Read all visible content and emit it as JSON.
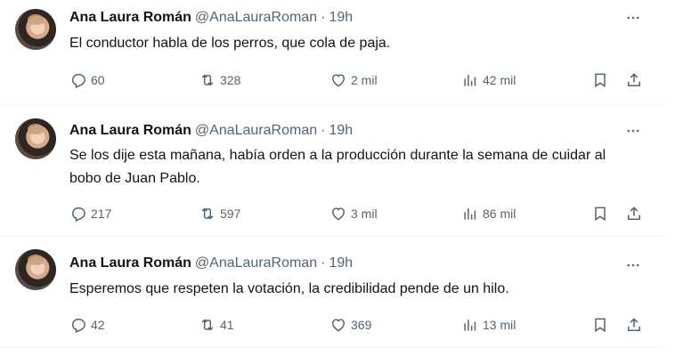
{
  "tweets": [
    {
      "name": "Ana Laura Román",
      "handle": "@AnaLauraRoman",
      "separator": "·",
      "time": "19h",
      "text": "El conductor habla de los perros, que cola de paja.",
      "replies": "60",
      "retweets": "328",
      "likes": "2 mil",
      "views": "42 mil"
    },
    {
      "name": "Ana Laura Román",
      "handle": "@AnaLauraRoman",
      "separator": "·",
      "time": "19h",
      "text": "Se los dije esta mañana, había orden a la producción durante la semana de cuidar al bobo de Juan Pablo.",
      "replies": "217",
      "retweets": "597",
      "likes": "3 mil",
      "views": "86 mil"
    },
    {
      "name": "Ana Laura Román",
      "handle": "@AnaLauraRoman",
      "separator": "·",
      "time": "19h",
      "text": "Esperemos que respeten la votación, la credibilidad pende de un hilo.",
      "replies": "42",
      "retweets": "41",
      "likes": "369",
      "views": "13 mil"
    }
  ],
  "icons": {
    "more": "more-horizontal-icon",
    "reply": "reply-icon",
    "retweet": "retweet-icon",
    "like": "heart-icon",
    "views": "views-chart-icon",
    "bookmark": "bookmark-icon",
    "share": "share-icon"
  },
  "colors": {
    "text": "#0f1419",
    "secondary": "#536471",
    "divider": "#eff3f4"
  }
}
